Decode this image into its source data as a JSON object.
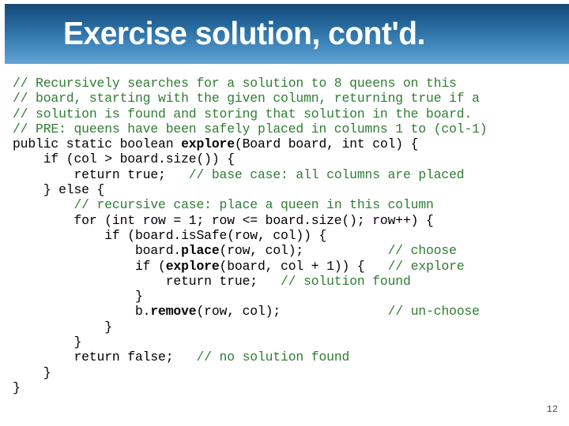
{
  "slide": {
    "title": "Exercise solution, cont'd.",
    "page_number": "12",
    "accent_color": "#2a6fa3",
    "comment_color": "#2e7d32",
    "code_color": "#000000",
    "banner_gradient_top": "#16466f",
    "banner_gradient_bottom": "#64a6d6"
  },
  "code": {
    "language": "java",
    "lines": [
      {
        "id": 1,
        "text": "// Recursively searches for a solution to 8 queens on this",
        "segments": [
          {
            "t": "// Recursively searches for a solution to 8 queens on this",
            "style": "comment"
          }
        ]
      },
      {
        "id": 2,
        "text": "// board, starting with the given column, returning true if a",
        "segments": [
          {
            "t": "// board, starting with the given column, returning true if a",
            "style": "comment"
          }
        ]
      },
      {
        "id": 3,
        "text": "// solution is found and storing that solution in the board.",
        "segments": [
          {
            "t": "// solution is found and storing that solution in the board.",
            "style": "comment"
          }
        ]
      },
      {
        "id": 4,
        "text": "// PRE: queens have been safely placed in columns 1 to (col-1)",
        "segments": [
          {
            "t": "// PRE: queens have been safely placed in columns 1 to (col-1)",
            "style": "comment"
          }
        ]
      },
      {
        "id": 5,
        "text": "public static boolean explore(Board board, int col) {",
        "segments": [
          {
            "t": "public static boolean ",
            "style": "plain"
          },
          {
            "t": "explore",
            "style": "bold"
          },
          {
            "t": "(Board board, int col) {",
            "style": "plain"
          }
        ]
      },
      {
        "id": 6,
        "text": "    if (col > board.size()) {",
        "segments": [
          {
            "t": "    if (col > board.size()) {",
            "style": "plain"
          }
        ]
      },
      {
        "id": 7,
        "text": "        return true;   // base case: all columns are placed",
        "segments": [
          {
            "t": "        return true;   ",
            "style": "plain"
          },
          {
            "t": "// base case: all columns are placed",
            "style": "comment"
          }
        ]
      },
      {
        "id": 8,
        "text": "    } else {",
        "segments": [
          {
            "t": "    } else {",
            "style": "plain"
          }
        ]
      },
      {
        "id": 9,
        "text": "        // recursive case: place a queen in this column",
        "segments": [
          {
            "t": "        ",
            "style": "plain"
          },
          {
            "t": "// recursive case: place a queen in this column",
            "style": "comment"
          }
        ]
      },
      {
        "id": 10,
        "text": "        for (int row = 1; row <= board.size(); row++) {",
        "segments": [
          {
            "t": "        for (int row = 1; row <= board.size(); row++) {",
            "style": "plain"
          }
        ]
      },
      {
        "id": 11,
        "text": "            if (board.isSafe(row, col)) {",
        "segments": [
          {
            "t": "            if (board.isSafe(row, col)) {",
            "style": "plain"
          }
        ]
      },
      {
        "id": 12,
        "text": "                board.place(row, col);           // choose",
        "segments": [
          {
            "t": "                board.",
            "style": "plain"
          },
          {
            "t": "place",
            "style": "bold"
          },
          {
            "t": "(row, col);           ",
            "style": "plain"
          },
          {
            "t": "// choose",
            "style": "comment"
          }
        ]
      },
      {
        "id": 13,
        "text": "                if (explore(board, col + 1)) {   // explore",
        "segments": [
          {
            "t": "                if (",
            "style": "plain"
          },
          {
            "t": "explore",
            "style": "bold"
          },
          {
            "t": "(board, col + 1)) {   ",
            "style": "plain"
          },
          {
            "t": "// explore",
            "style": "comment"
          }
        ]
      },
      {
        "id": 14,
        "text": "                    return true;   // solution found",
        "segments": [
          {
            "t": "                    return true;   ",
            "style": "plain"
          },
          {
            "t": "// solution found",
            "style": "comment"
          }
        ]
      },
      {
        "id": 15,
        "text": "                }",
        "segments": [
          {
            "t": "                }",
            "style": "plain"
          }
        ]
      },
      {
        "id": 16,
        "text": "                b.remove(row, col);              // un-choose",
        "segments": [
          {
            "t": "                b.",
            "style": "plain"
          },
          {
            "t": "remove",
            "style": "bold"
          },
          {
            "t": "(row, col);              ",
            "style": "plain"
          },
          {
            "t": "// un-choose",
            "style": "comment"
          }
        ]
      },
      {
        "id": 17,
        "text": "            }",
        "segments": [
          {
            "t": "            }",
            "style": "plain"
          }
        ]
      },
      {
        "id": 18,
        "text": "        }",
        "segments": [
          {
            "t": "        }",
            "style": "plain"
          }
        ]
      },
      {
        "id": 19,
        "text": "        return false;   // no solution found",
        "segments": [
          {
            "t": "        return false;   ",
            "style": "plain"
          },
          {
            "t": "// no solution found",
            "style": "comment"
          }
        ]
      },
      {
        "id": 20,
        "text": "    }",
        "segments": [
          {
            "t": "    }",
            "style": "plain"
          }
        ]
      },
      {
        "id": 21,
        "text": "}",
        "segments": [
          {
            "t": "}",
            "style": "plain"
          }
        ]
      }
    ]
  }
}
